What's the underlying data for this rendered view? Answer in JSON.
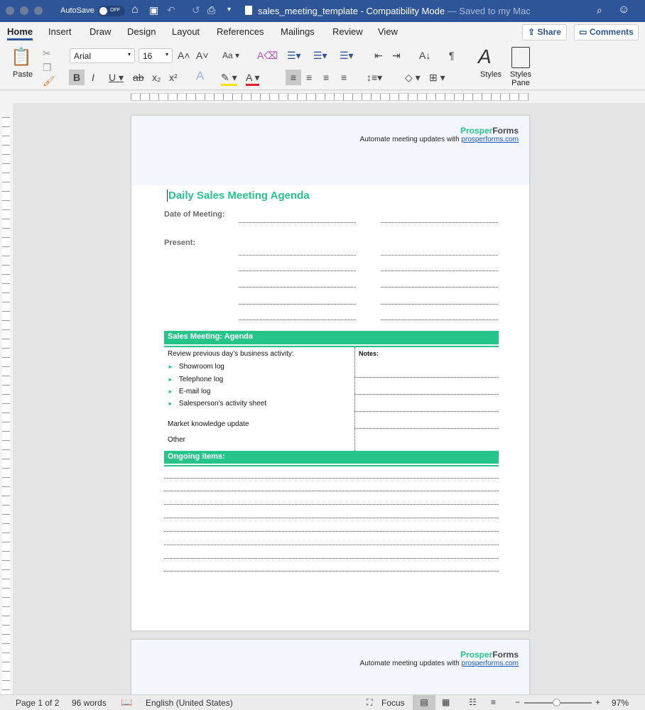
{
  "titlebar": {
    "autosave": "AutoSave",
    "autosave_state": "OFF",
    "filename": "sales_meeting_template",
    "separator": "-",
    "mode": "Compatibility Mode",
    "saved": "— Saved to my Mac"
  },
  "tabs": [
    "Home",
    "Insert",
    "Draw",
    "Design",
    "Layout",
    "References",
    "Mailings",
    "Review",
    "View"
  ],
  "share": "Share",
  "comments": "Comments",
  "ribbon": {
    "paste": "Paste",
    "font": "Arial",
    "size": "16",
    "styles": "Styles",
    "styles_pane": "Styles Pane"
  },
  "doc": {
    "logo_a": "Prosper",
    "logo_b": "Forms",
    "tagline": "Automate meeting updates with ",
    "link": "prosperforms.com",
    "title": "Daily Sales Meeting Agenda",
    "date_label": "Date of Meeting:",
    "present_label": "Present:",
    "agenda_header": "Sales Meeting: Agenda",
    "review": "Review previous day’s business activity:",
    "bullets": [
      "Showroom log",
      "Telephone log",
      "E-mail log",
      "Salesperson’s activity sheet"
    ],
    "market": "Market knowledge update",
    "other": "Other",
    "notes": "Notes:",
    "ongoing": "Ongoing items:"
  },
  "status": {
    "page": "Page 1 of 2",
    "words": "96 words",
    "language": "English (United States)",
    "focus": "Focus",
    "zoom": "97%"
  },
  "colors": {
    "accent": "#27c48a",
    "titlebar": "#2e5597"
  }
}
